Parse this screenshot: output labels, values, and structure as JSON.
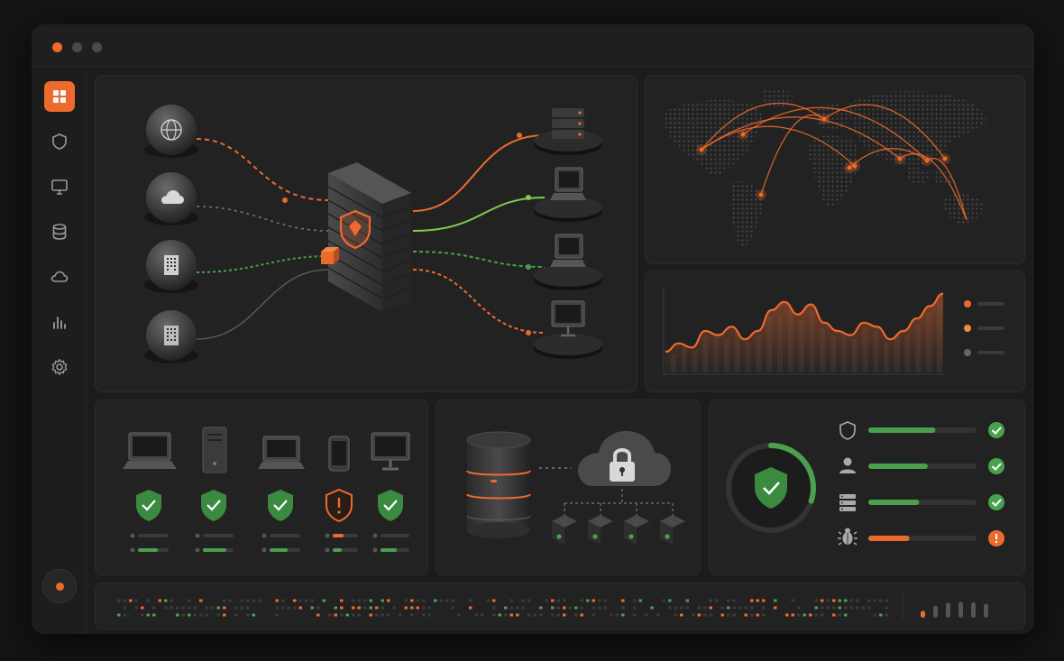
{
  "colors": {
    "accent": "#ee6a2c",
    "success": "#4aa04d",
    "line_green": "#7ecb4e",
    "panel_bg": "#222223",
    "window_bg": "#1c1c1d"
  },
  "window_controls": [
    "close",
    "minimize",
    "maximize"
  ],
  "sidebar": {
    "items": [
      {
        "icon": "dashboard-grid-icon",
        "active": true
      },
      {
        "icon": "shield-icon",
        "active": false
      },
      {
        "icon": "monitor-icon",
        "active": false
      },
      {
        "icon": "database-icon",
        "active": false
      },
      {
        "icon": "cloud-icon",
        "active": false
      },
      {
        "icon": "bar-chart-icon",
        "active": false
      },
      {
        "icon": "gear-icon",
        "active": false
      }
    ],
    "footer_icon": "record-icon"
  },
  "network_flow": {
    "sources": [
      "globe-icon",
      "cloud-icon",
      "building-icon",
      "building-icon"
    ],
    "gateway": "firewall-shield-icon",
    "targets": [
      "server-stack-icon",
      "laptop-icon",
      "laptop-icon",
      "desktop-monitor-icon"
    ]
  },
  "threat_map": {
    "hotspots": 9
  },
  "traffic_chart": {
    "values": [
      0.25,
      0.35,
      0.3,
      0.5,
      0.45,
      0.55,
      0.4,
      0.5,
      0.75,
      0.85,
      0.7,
      0.82,
      0.6,
      0.5,
      0.45,
      0.6,
      0.55,
      0.4,
      0.5,
      0.65,
      0.8,
      0.95
    ],
    "legend": [
      "#ee6a2c",
      "#f08a45",
      "#666666"
    ]
  },
  "devices": [
    {
      "icon": "laptop-icon",
      "status": "ok"
    },
    {
      "icon": "server-tower-icon",
      "status": "ok"
    },
    {
      "icon": "laptop-icon",
      "status": "ok"
    },
    {
      "icon": "phone-icon",
      "status": "warning"
    },
    {
      "icon": "desktop-monitor-icon",
      "status": "ok"
    }
  ],
  "backup": {
    "source": "database-stack-icon",
    "target": "cloud-lock-icon",
    "nodes": 4
  },
  "security_status": {
    "overall": "ok",
    "ring_progress": 0.3,
    "checks": [
      {
        "icon": "shield-icon",
        "progress": 0.62,
        "status": "ok"
      },
      {
        "icon": "user-icon",
        "progress": 0.55,
        "status": "ok"
      },
      {
        "icon": "server-icon",
        "progress": 0.47,
        "status": "ok"
      },
      {
        "icon": "bug-icon",
        "progress": 0.38,
        "status": "alert"
      }
    ]
  },
  "activity_log": {
    "levels": [
      0.35,
      0.6,
      0.75,
      0.8,
      0.78,
      0.7
    ]
  }
}
